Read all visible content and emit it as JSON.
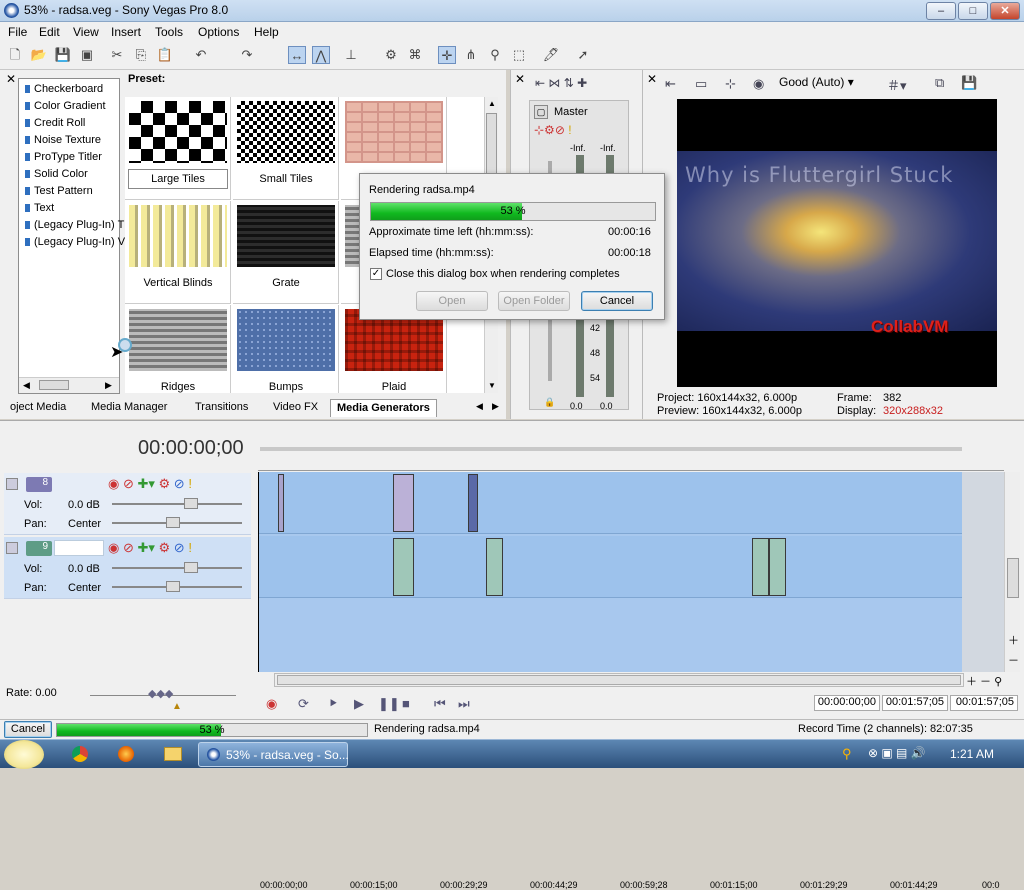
{
  "window": {
    "title": "53% - radsa.veg - Sony Vegas Pro 8.0",
    "min": "–",
    "max": "□",
    "close": "✕"
  },
  "menu": [
    "File",
    "Edit",
    "View",
    "Insert",
    "Tools",
    "Options",
    "Help"
  ],
  "generators": {
    "items": [
      "Checkerboard",
      "Color Gradient",
      "Credit Roll",
      "Noise Texture",
      "ProType Titler",
      "Solid Color",
      "Test Pattern",
      "Text",
      "(Legacy Plug-In) T",
      "(Legacy Plug-In) V"
    ],
    "preset_label": "Preset:",
    "presets": [
      "Large Tiles",
      "Small Tiles",
      "Vertical Blinds",
      "Grate",
      "Ridges",
      "Bumps",
      "Plaid"
    ]
  },
  "tabs": [
    "oject Media",
    "Media Manager",
    "Transitions",
    "Video FX",
    "Media Generators"
  ],
  "mixer": {
    "label": "Master",
    "left_peak": "-Inf.",
    "right_peak": "-Inf.",
    "scale": [
      "42",
      "48",
      "54"
    ],
    "left_val": "0.0",
    "right_val": "0.0"
  },
  "preview": {
    "quality": "Good (Auto)",
    "video_caption": "Why is Fluttergirl Stuck",
    "watermark": "CollabVM",
    "project_label": "Project:",
    "project_value": "160x144x32, 6.000p",
    "preview_label": "Preview:",
    "preview_value": "160x144x32, 6.000p",
    "frame_label": "Frame:",
    "frame_value": "382",
    "display_label": "Display:",
    "display_value": "320x288x32"
  },
  "render_dialog": {
    "title": "Rendering radsa.mp4",
    "progress": 53,
    "progress_text": "53 %",
    "time_left_label": "Approximate time left (hh:mm:ss):",
    "time_left_value": "00:00:16",
    "elapsed_label": "Elapsed time (hh:mm:ss):",
    "elapsed_value": "00:00:18",
    "close_checkbox_label": "Close this dialog box when rendering completes",
    "close_checked": true,
    "open_button": "Open",
    "open_folder_button": "Open Folder",
    "cancel_button": "Cancel"
  },
  "timeline": {
    "timecode": "00:00:00;00",
    "ruler": [
      "00:00:00;00",
      "00:00:15;00",
      "00:00:29;29",
      "00:00:44;29",
      "00:00:59;28",
      "00:01:15;00",
      "00:01:29;29",
      "00:01:44;29",
      "00:0"
    ],
    "tracks": [
      {
        "number": "8",
        "vol_label": "Vol:",
        "vol_value": "0.0 dB",
        "pan_label": "Pan:",
        "pan_value": "Center"
      },
      {
        "number": "9",
        "vol_label": "Vol:",
        "vol_value": "0.0 dB",
        "pan_label": "Pan:",
        "pan_value": "Center"
      }
    ],
    "rate_label": "Rate: 0.00",
    "time_start": "00:00:00;00",
    "time_end": "00:01:57;05",
    "time_length": "00:01:57;05"
  },
  "status": {
    "cancel_button": "Cancel",
    "progress": 53,
    "progress_text": "53 %",
    "message": "Rendering radsa.mp4",
    "record_time": "Record Time (2 channels): 82:07:35"
  },
  "taskbar": {
    "task_label": "53% - radsa.veg - So...",
    "clock": "1:21 AM"
  },
  "colors": {
    "progress_green": "#19c42c",
    "timeline_bg": "#a8c8ee",
    "track_blue": "#93bce9"
  }
}
